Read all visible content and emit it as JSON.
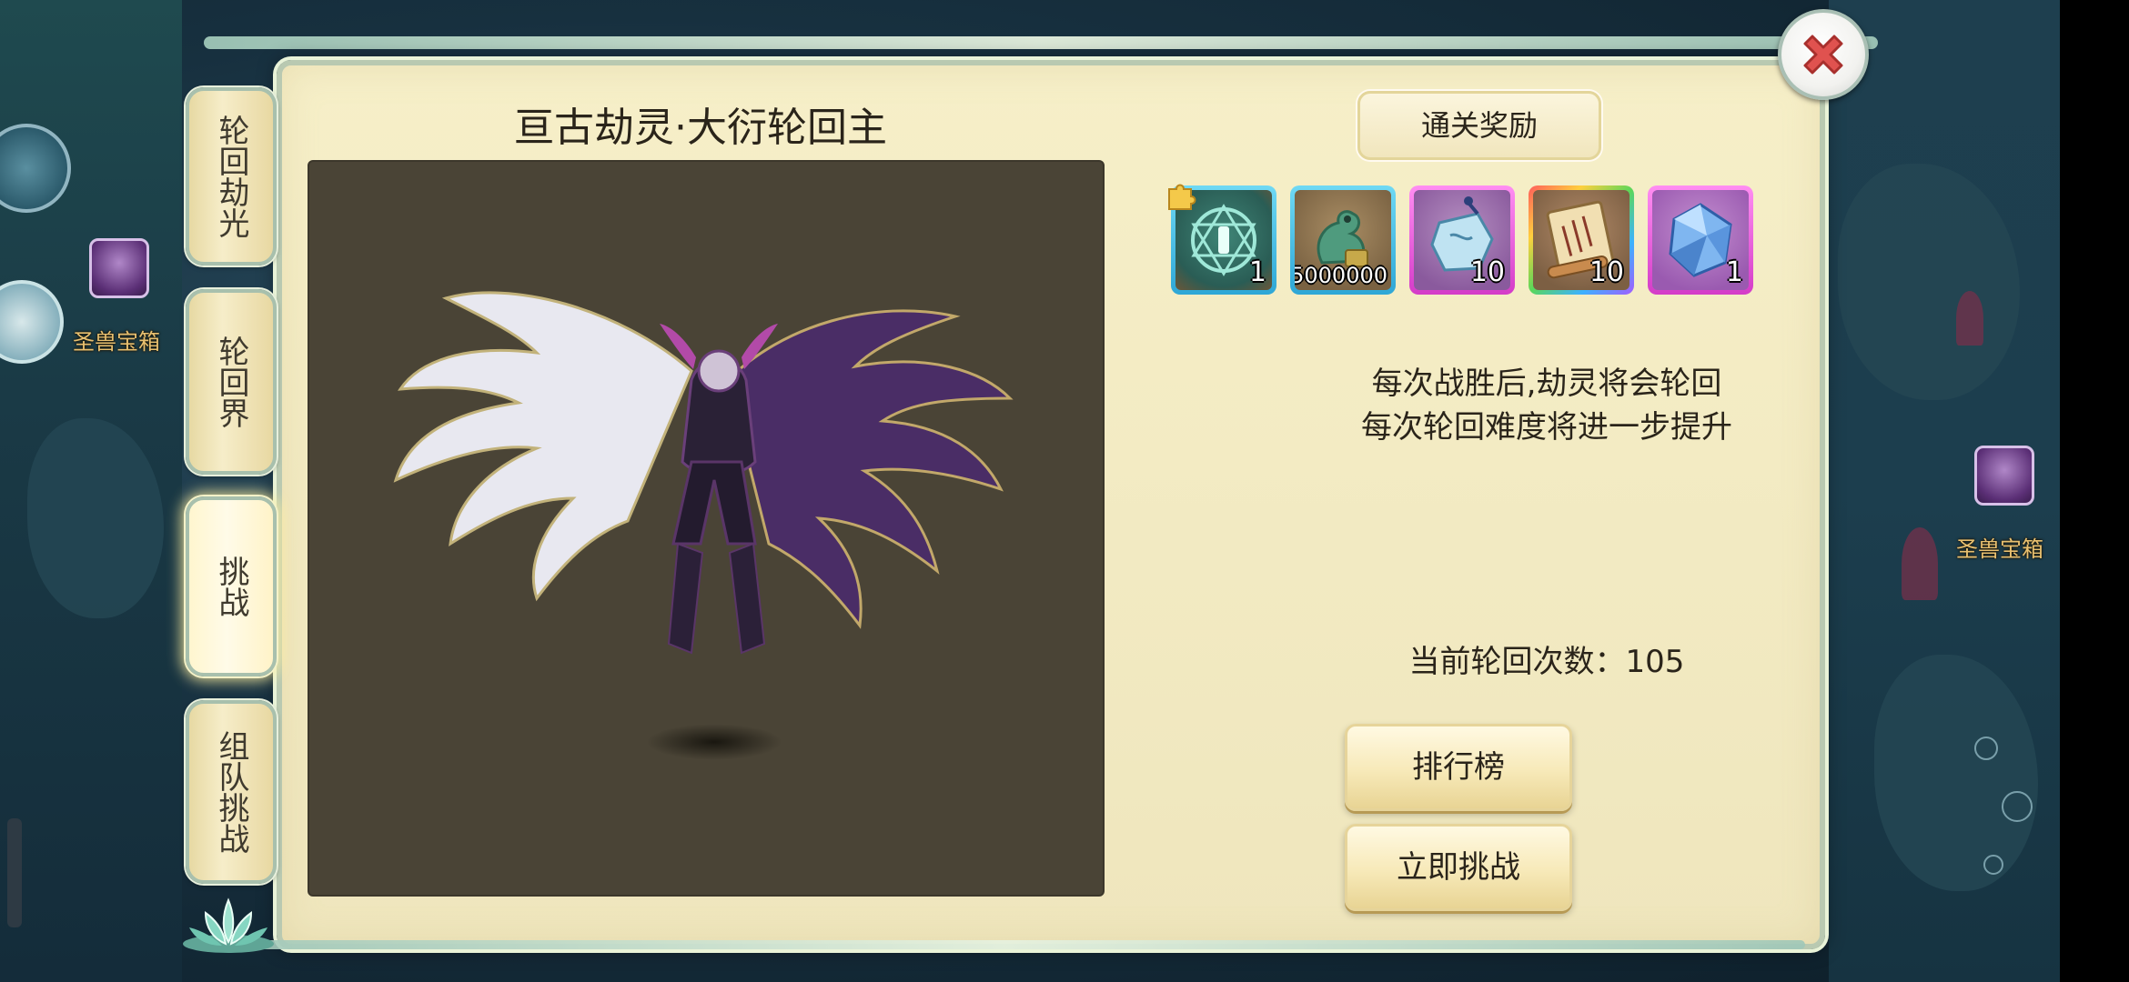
{
  "tabs": [
    {
      "label": "轮回劫光"
    },
    {
      "label": "轮回界"
    },
    {
      "label": "挑战"
    },
    {
      "label": "组队挑战"
    }
  ],
  "active_tab": "挑战",
  "boss": {
    "title": "亘古劫灵·大衍轮回主"
  },
  "rewards": {
    "header": "通关奖励",
    "items": [
      {
        "icon": "formation-scroll-icon",
        "frame": "blue",
        "quantity": "1"
      },
      {
        "icon": "jade-dragon-icon",
        "frame": "blue",
        "quantity": "5000000"
      },
      {
        "icon": "spirit-stone-icon",
        "frame": "pink",
        "quantity": "10"
      },
      {
        "icon": "scroll-icon",
        "frame": "rainbow",
        "quantity": "10"
      },
      {
        "icon": "crystal-icon",
        "frame": "pink",
        "quantity": "1"
      }
    ]
  },
  "description": {
    "line1": "每次战胜后,劫灵将会轮回",
    "line2": "每次轮回难度将进一步提升"
  },
  "cycle_count_text": "当前轮回次数：105",
  "buttons": {
    "ranking": "排行榜",
    "challenge_now": "立即挑战"
  },
  "background": {
    "chest_label_left": "圣兽宝箱",
    "chest_label_right": "圣兽宝箱"
  },
  "colors": {
    "panel_bg": "#f3ebc4",
    "boss_view_bg": "#4a4436",
    "close_red": "#e0524f"
  }
}
